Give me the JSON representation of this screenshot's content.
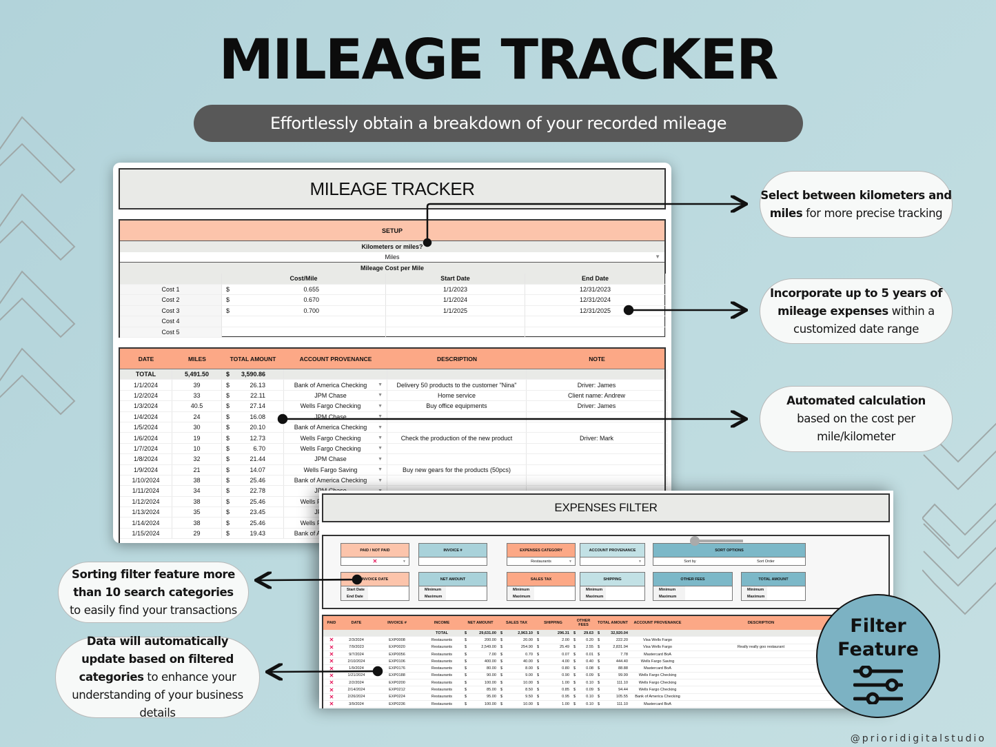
{
  "header": {
    "title": "MILEAGE TRACKER",
    "subtitle": "Effortlessly obtain a breakdown of your recorded mileage"
  },
  "mileage_sheet": {
    "title": "MILEAGE TRACKER",
    "setup": {
      "heading": "SETUP",
      "unit_question": "Kilometers or miles?",
      "unit_value": "Miles",
      "cost_heading": "Mileage Cost per Mile",
      "columns": [
        "",
        "Cost/Mile",
        "Start Date",
        "End Date"
      ],
      "costs": [
        {
          "label": "Cost 1",
          "currency": "$",
          "rate": "0.655",
          "start": "1/1/2023",
          "end": "12/31/2023"
        },
        {
          "label": "Cost 2",
          "currency": "$",
          "rate": "0.670",
          "start": "1/1/2024",
          "end": "12/31/2024"
        },
        {
          "label": "Cost 3",
          "currency": "$",
          "rate": "0.700",
          "start": "1/1/2025",
          "end": "12/31/2025"
        },
        {
          "label": "Cost 4",
          "currency": "",
          "rate": "",
          "start": "",
          "end": ""
        },
        {
          "label": "Cost 5",
          "currency": "",
          "rate": "",
          "start": "",
          "end": ""
        }
      ]
    },
    "log": {
      "columns": [
        "DATE",
        "MILES",
        "TOTAL AMOUNT",
        "ACCOUNT PROVENANCE",
        "DESCRIPTION",
        "NOTE"
      ],
      "total": {
        "label": "TOTAL",
        "miles": "5,491.50",
        "currency": "$",
        "amount": "3,590.86"
      },
      "rows": [
        {
          "date": "1/1/2024",
          "miles": "39",
          "amount": "26.13",
          "account": "Bank of America Checking",
          "description": "Delivery 50 products to the customer \"Nina\"",
          "note": "Driver: James"
        },
        {
          "date": "1/2/2024",
          "miles": "33",
          "amount": "22.11",
          "account": "JPM Chase",
          "description": "Home service",
          "note": "Client name: Andrew"
        },
        {
          "date": "1/3/2024",
          "miles": "40.5",
          "amount": "27.14",
          "account": "Wells Fargo Checking",
          "description": "Buy office equipments",
          "note": "Driver: James"
        },
        {
          "date": "1/4/2024",
          "miles": "24",
          "amount": "16.08",
          "account": "JPM Chase",
          "description": "",
          "note": ""
        },
        {
          "date": "1/5/2024",
          "miles": "30",
          "amount": "20.10",
          "account": "Bank of America Checking",
          "description": "",
          "note": ""
        },
        {
          "date": "1/6/2024",
          "miles": "19",
          "amount": "12.73",
          "account": "Wells Fargo Checking",
          "description": "Check the production of the new product",
          "note": "Driver: Mark"
        },
        {
          "date": "1/7/2024",
          "miles": "10",
          "amount": "6.70",
          "account": "Wells Fargo Checking",
          "description": "",
          "note": ""
        },
        {
          "date": "1/8/2024",
          "miles": "32",
          "amount": "21.44",
          "account": "JPM Chase",
          "description": "",
          "note": ""
        },
        {
          "date": "1/9/2024",
          "miles": "21",
          "amount": "14.07",
          "account": "Wells Fargo Saving",
          "description": "Buy new gears for the products (50pcs)",
          "note": ""
        },
        {
          "date": "1/10/2024",
          "miles": "38",
          "amount": "25.46",
          "account": "Bank of America Checking",
          "description": "",
          "note": ""
        },
        {
          "date": "1/11/2024",
          "miles": "34",
          "amount": "22.78",
          "account": "JPM Chase",
          "description": "",
          "note": ""
        },
        {
          "date": "1/12/2024",
          "miles": "38",
          "amount": "25.46",
          "account": "Wells Fargo Checking",
          "description": "",
          "note": ""
        },
        {
          "date": "1/13/2024",
          "miles": "35",
          "amount": "23.45",
          "account": "JPM Chase",
          "description": "",
          "note": ""
        },
        {
          "date": "1/14/2024",
          "miles": "38",
          "amount": "25.46",
          "account": "Wells Fargo Checking",
          "description": "",
          "note": ""
        },
        {
          "date": "1/15/2024",
          "miles": "29",
          "amount": "19.43",
          "account": "Bank of America Checking",
          "description": "",
          "note": ""
        }
      ]
    }
  },
  "filter_sheet": {
    "title": "EXPENSES FILTER",
    "filters": {
      "paid": {
        "label": "PAID / NOT PAID",
        "value": "✕"
      },
      "invoice": {
        "label": "INVOICE #",
        "value": ""
      },
      "category": {
        "label": "EXPENSES CATEGORY",
        "value": "Restaurants"
      },
      "account": {
        "label": "ACCOUNT PROVENANCE",
        "value": ""
      },
      "sort": {
        "label": "SORT OPTIONS",
        "sort_by": "Sort by",
        "sort_order": "Sort Order"
      },
      "invoice_date": {
        "label": "INVOICE DATE",
        "start": "Start Date",
        "end": "End Date"
      },
      "net_amount": {
        "label": "NET AMOUNT",
        "min": "Minimum",
        "max": "Maximum"
      },
      "sales_tax": {
        "label": "SALES TAX",
        "min": "Minimum",
        "max": "Maximum"
      },
      "shipping": {
        "label": "SHIPPING",
        "min": "Minimum",
        "max": "Maximum"
      },
      "other_fees": {
        "label": "OTHER FEES",
        "min": "Minimum",
        "max": "Maximum"
      },
      "total_amount": {
        "label": "TOTAL AMOUNT",
        "min": "Minimum",
        "max": "Maximum"
      }
    },
    "table": {
      "columns": [
        "PAID",
        "DATE",
        "INVOICE #",
        "INCOME",
        "NET AMOUNT",
        "SALES TAX",
        "SHIPPING",
        "OTHER FEES",
        "TOTAL AMOUNT",
        "ACCOUNT PROVENANCE",
        "DESCRIPTION"
      ],
      "total": {
        "label": "TOTAL",
        "net": "29,631.00",
        "tax": "2,963.10",
        "shipping": "296.31",
        "fees": "29.63",
        "total": "32,920.04"
      },
      "rows": [
        {
          "paid": "✕",
          "date": "2/3/2024",
          "invoice": "EXP0008",
          "income": "Restaurants",
          "net": "200.00",
          "tax": "20.00",
          "shipping": "2.00",
          "fees": "0.20",
          "total": "222.20",
          "account": "Visa Wells Fargo",
          "description": ""
        },
        {
          "paid": "✕",
          "date": "7/9/2023",
          "invoice": "EXP0020",
          "income": "Restaurants",
          "net": "2,549.00",
          "tax": "254.90",
          "shipping": "25.49",
          "fees": "2.55",
          "total": "2,831.94",
          "account": "Visa Wells Fargo",
          "description": "Really really goo restaurant"
        },
        {
          "paid": "✕",
          "date": "9/7/2024",
          "invoice": "EXP0056",
          "income": "Restaurants",
          "net": "7.00",
          "tax": "0.70",
          "shipping": "0.07",
          "fees": "0.01",
          "total": "7.78",
          "account": "Mastercard BoA",
          "description": ""
        },
        {
          "paid": "✕",
          "date": "2/10/2024",
          "invoice": "EXP0106",
          "income": "Restaurants",
          "net": "400.00",
          "tax": "40.00",
          "shipping": "4.00",
          "fees": "0.40",
          "total": "444.40",
          "account": "Wells Fargo Saving",
          "description": ""
        },
        {
          "paid": "✕",
          "date": "1/9/2024",
          "invoice": "EXP0176",
          "income": "Restaurants",
          "net": "80.00",
          "tax": "8.00",
          "shipping": "0.80",
          "fees": "0.08",
          "total": "88.88",
          "account": "Mastercard BoA",
          "description": ""
        },
        {
          "paid": "✕",
          "date": "1/21/2024",
          "invoice": "EXP0188",
          "income": "Restaurants",
          "net": "90.00",
          "tax": "9.00",
          "shipping": "0.90",
          "fees": "0.09",
          "total": "99.99",
          "account": "Wells Fargo Checking",
          "description": ""
        },
        {
          "paid": "✕",
          "date": "2/2/2024",
          "invoice": "EXP0200",
          "income": "Restaurants",
          "net": "100.00",
          "tax": "10.00",
          "shipping": "1.00",
          "fees": "0.10",
          "total": "111.10",
          "account": "Wells Fargo Checking",
          "description": ""
        },
        {
          "paid": "✕",
          "date": "2/14/2024",
          "invoice": "EXP0212",
          "income": "Restaurants",
          "net": "85.00",
          "tax": "8.50",
          "shipping": "0.85",
          "fees": "0.09",
          "total": "94.44",
          "account": "Wells Fargo Checking",
          "description": ""
        },
        {
          "paid": "✕",
          "date": "2/26/2024",
          "invoice": "EXP0224",
          "income": "Restaurants",
          "net": "95.00",
          "tax": "9.50",
          "shipping": "0.95",
          "fees": "0.10",
          "total": "105.55",
          "account": "Bank of America Checking",
          "description": ""
        },
        {
          "paid": "✕",
          "date": "3/9/2024",
          "invoice": "EXP0236",
          "income": "Restaurants",
          "net": "100.00",
          "tax": "10.00",
          "shipping": "1.00",
          "fees": "0.10",
          "total": "111.10",
          "account": "Mastercard BoA",
          "description": ""
        }
      ]
    }
  },
  "callouts": {
    "units": {
      "bold": "Select between kilometers and miles",
      "rest": " for more precise tracking"
    },
    "years": {
      "bold": "Incorporate up to 5 years of mileage expenses",
      "rest": " within a customized date range"
    },
    "auto": {
      "bold": "Automated calculation",
      "rest": " based on the cost per mile/kilometer"
    },
    "sorting": {
      "bold": "Sorting filter feature more than 10 search categories",
      "rest": " to easily find your transactions"
    },
    "update": {
      "bold": "Data will automatically update based on filtered categories",
      "rest": " to enhance your understanding of your business details"
    }
  },
  "badge": {
    "line1": "Filter",
    "line2": "Feature",
    "icon": "sliders-icon"
  },
  "watermark": "@prioridigitalstudio",
  "colors": {
    "background": "#b8d7dc",
    "salmon": "#fcc4ab",
    "orange": "#fca886",
    "teal": "#7cb2c3",
    "pill": "#585858",
    "x_mark": "#e5175a"
  }
}
